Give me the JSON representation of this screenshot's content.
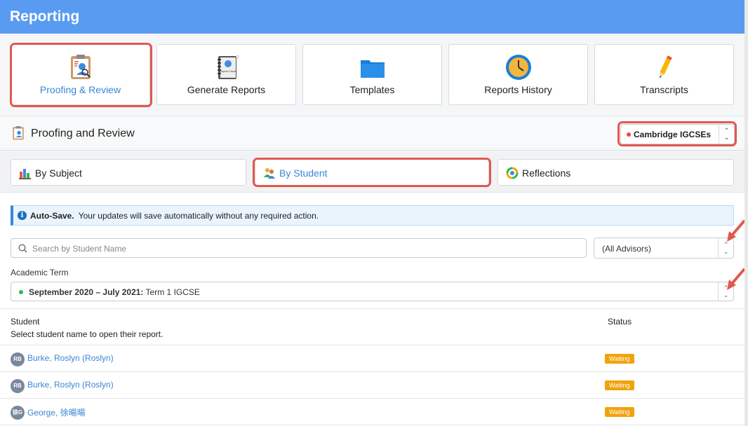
{
  "app": {
    "title": "Reporting"
  },
  "modules": [
    {
      "label": "Proofing & Review",
      "icon": "clipboard-review-icon"
    },
    {
      "label": "Generate Reports",
      "icon": "report-cards-notebook-icon",
      "icon_text": "Report Cards"
    },
    {
      "label": "Templates",
      "icon": "folder-icon"
    },
    {
      "label": "Reports History",
      "icon": "clock-icon"
    },
    {
      "label": "Transcripts",
      "icon": "pencil-icon"
    }
  ],
  "section": {
    "title": "Proofing and Review",
    "program_select": "Cambridge IGCSEs",
    "program_dot_color": "#e5483e"
  },
  "tabs": [
    {
      "label": "By Subject",
      "icon": "bar-chart-icon"
    },
    {
      "label": "By Student",
      "icon": "students-icon"
    },
    {
      "label": "Reflections",
      "icon": "reflections-cycle-icon"
    }
  ],
  "alert": {
    "title": "Auto-Save.",
    "message": "Your updates will save automatically without any required action."
  },
  "filters": {
    "search_placeholder": "Search by Student Name",
    "advisor_value": "(All Advisors)",
    "term_label": "Academic Term",
    "term_bold": "September 2020 – July 2021:",
    "term_rest": " Term 1 IGCSE",
    "term_dot_color": "#2db84c"
  },
  "table": {
    "col_student": "Student",
    "col_student_hint": "Select student name to open their report.",
    "col_status": "Status",
    "rows": [
      {
        "initials": "RB",
        "name": "Burke, Roslyn (Roslyn)",
        "status": "Waiting"
      },
      {
        "initials": "RB",
        "name": "Burke, Roslyn (Roslyn)",
        "status": "Waiting"
      },
      {
        "initials": "徐G",
        "name": "George, 徐暘暘",
        "status": "Waiting"
      }
    ]
  },
  "colors": {
    "header": "#5a9bf2",
    "accent": "#3a86d6",
    "highlight": "#e0594f",
    "waiting": "#f0a30a"
  }
}
